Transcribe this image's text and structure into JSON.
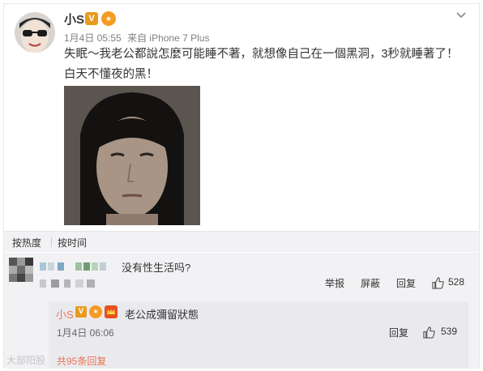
{
  "post": {
    "author": "小S",
    "time": "1月4日 05:55",
    "source": "来自 iPhone 7 Plus",
    "text": "失眠～我老公都說怎麼可能睡不著，就想像自己在一個黑洞，3秒就睡著了！白天不懂夜的黑！"
  },
  "sort": {
    "hot_label": "按热度",
    "time_label": "按时间"
  },
  "comment": {
    "text": "没有性生活吗?",
    "report_label": "举报",
    "block_label": "屏蔽",
    "reply_label": "回复",
    "like_count": "528"
  },
  "reply": {
    "author": "小S",
    "text": "老公成彌留狀態",
    "time": "1月4日 06:06",
    "reply_label": "回复",
    "like_count": "539",
    "more_label": "共95条回复"
  },
  "watermark": "大部阳股",
  "colors": {
    "accent": "#eb7350",
    "vip_badge": "#e89b1e",
    "background_gray": "#f2f2f5"
  }
}
